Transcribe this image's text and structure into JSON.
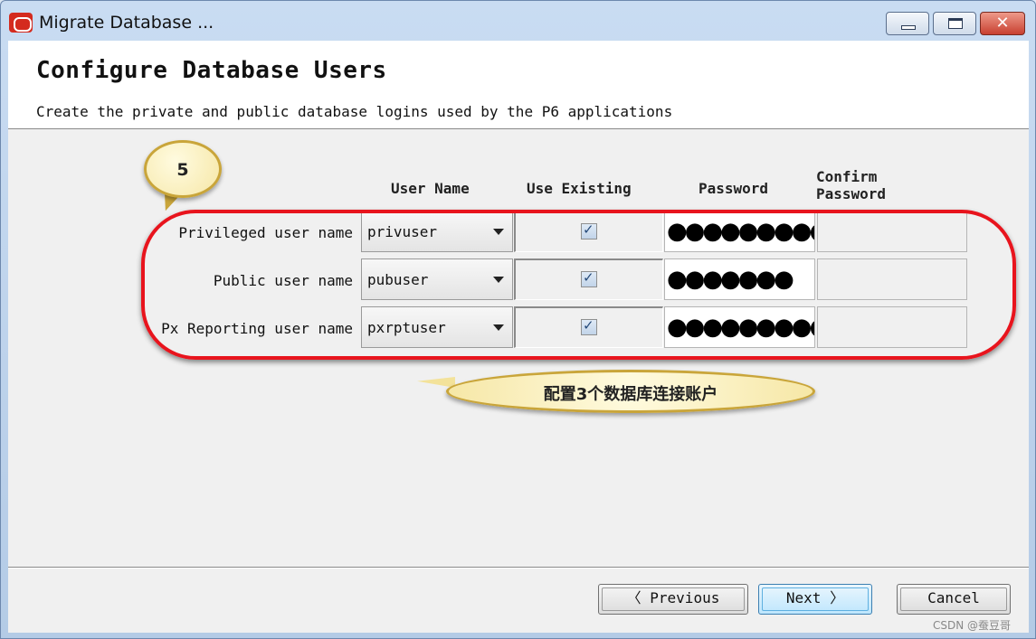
{
  "window": {
    "title": "Migrate Database ...",
    "controls": [
      "minimize-icon",
      "maximize-icon",
      "close-icon"
    ],
    "close_glyph": "✕"
  },
  "header": {
    "title": "Configure Database Users",
    "subtitle": "Create the private and public database logins used by the P6 applications"
  },
  "columns": {
    "user_name": "User Name",
    "use_existing": "Use Existing",
    "password": "Password",
    "confirm_line1": "Confirm",
    "confirm_line2": "Password"
  },
  "rows": [
    {
      "label": "Privileged user name",
      "user": "privuser",
      "use_existing": true,
      "password_mask": "●●●●●●●●●",
      "confirm_mask": ""
    },
    {
      "label": "Public user name",
      "user": "pubuser",
      "use_existing": true,
      "password_mask": "●●●●●●●",
      "confirm_mask": ""
    },
    {
      "label": "Px Reporting user name",
      "user": "pxrptuser",
      "use_existing": true,
      "password_mask": "●●●●●●●●●●",
      "confirm_mask": ""
    }
  ],
  "annotations": {
    "step_number": "5",
    "note": "配置3个数据库连接账户",
    "highlight_color": "#e8141d"
  },
  "footer": {
    "previous_label": "〈 Previous",
    "next_label": "Next 〉",
    "cancel_label": "Cancel"
  },
  "watermark": "CSDN @蚕豆哥"
}
